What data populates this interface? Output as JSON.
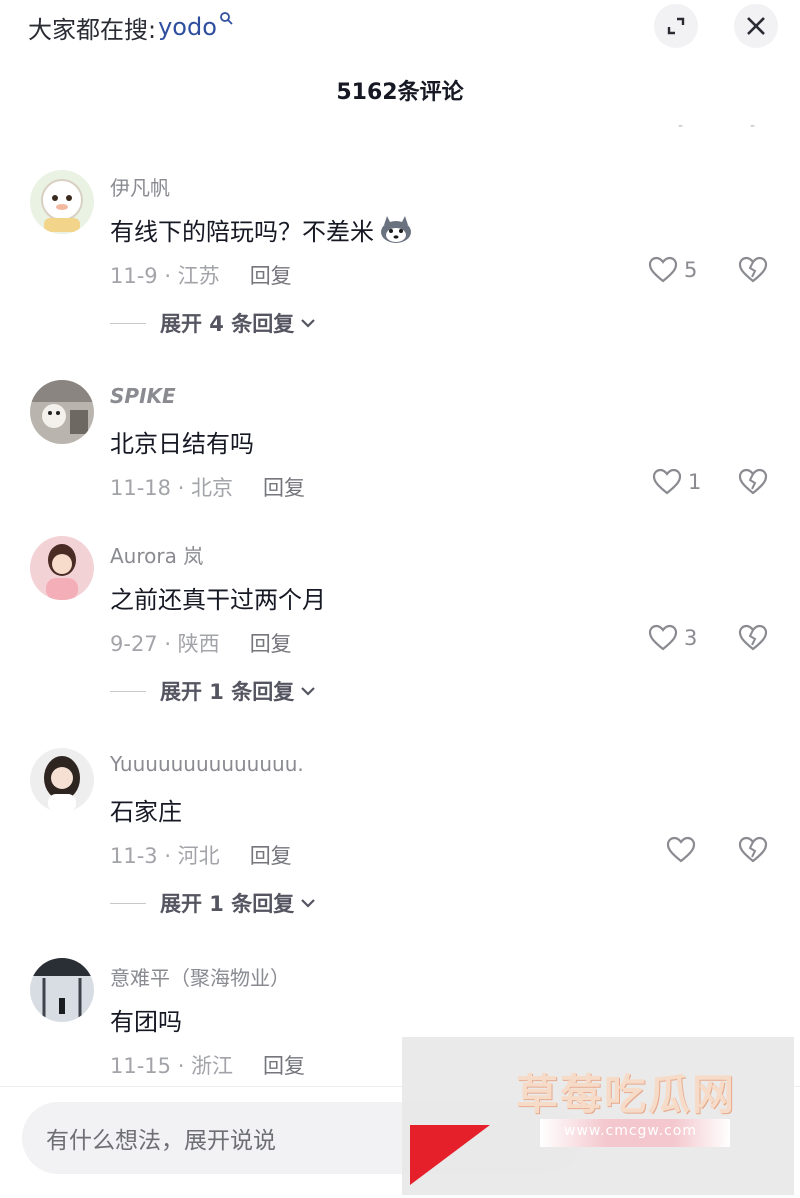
{
  "header": {
    "search_prefix": "大家都在搜:",
    "search_keyword": "yodo",
    "count_title": "5162条评论"
  },
  "comments": [
    {
      "username": "伊凡帆",
      "text": "有线下的陪玩吗？不差米",
      "date_location": "11-9 · 江苏",
      "reply_label": "回复",
      "likes": "5",
      "expand_label": "展开 4 条回复"
    },
    {
      "username": "SPIKE",
      "text": "北京日结有吗",
      "date_location": "11-18 · 北京",
      "reply_label": "回复",
      "likes": "1",
      "expand_label": ""
    },
    {
      "username": "Aurora 岚",
      "text": "之前还真干过两个月",
      "date_location": "9-27 · 陕西",
      "reply_label": "回复",
      "likes": "3",
      "expand_label": "展开 1 条回复"
    },
    {
      "username": "Yuuuuuuuuuuuuuu.",
      "text": "石家庄",
      "date_location": "11-3 · 河北",
      "reply_label": "回复",
      "likes": "",
      "expand_label": "展开 1 条回复"
    },
    {
      "username": "意难平（聚海物业）",
      "text": "有团吗",
      "date_location": "11-15 · 浙江",
      "reply_label": "回复",
      "likes": "",
      "expand_label": ""
    }
  ],
  "input": {
    "placeholder": "有什么想法，展开说说"
  },
  "watermark": {
    "title": "草莓吃瓜网",
    "url": "www.cmcgw.com"
  },
  "colors": {
    "keyword": "#2f4f9e",
    "watermark_red": "#e5202a"
  }
}
